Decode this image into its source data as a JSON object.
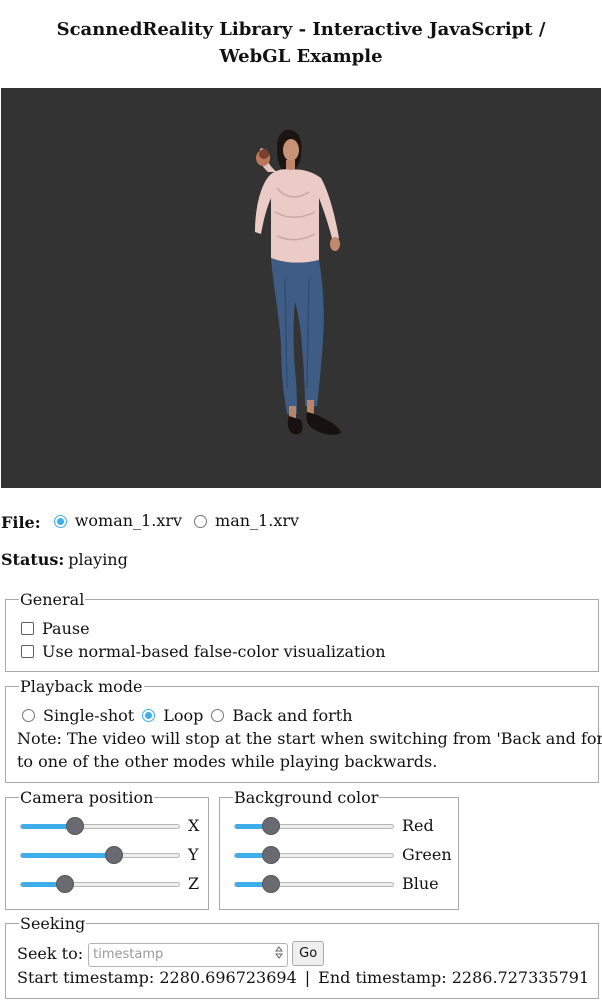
{
  "page": {
    "title": "ScannedReality Library - Interactive JavaScript / WebGL Example"
  },
  "viewer": {
    "background": "#333333"
  },
  "file": {
    "label": "File:",
    "options": [
      {
        "label": "woman_1.xrv",
        "checked": true
      },
      {
        "label": "man_1.xrv",
        "checked": false
      }
    ]
  },
  "status": {
    "label": "Status:",
    "value": "playing"
  },
  "general": {
    "legend": "General",
    "options": [
      {
        "label": "Pause",
        "checked": false
      },
      {
        "label": "Use normal-based false-color visualization",
        "checked": false
      }
    ]
  },
  "playback": {
    "legend": "Playback mode",
    "options": [
      {
        "label": "Single-shot",
        "checked": false
      },
      {
        "label": "Loop",
        "checked": true
      },
      {
        "label": "Back and forth",
        "checked": false
      }
    ],
    "note_line1": "Note: The video will stop at the start when switching from 'Back and forth'",
    "note_line2": "to one of the other modes while playing backwards."
  },
  "camera": {
    "legend": "Camera position",
    "sliders": [
      {
        "axis": "X",
        "value": 0.34
      },
      {
        "axis": "Y",
        "value": 0.59
      },
      {
        "axis": "Z",
        "value": 0.28
      }
    ]
  },
  "background_color": {
    "legend": "Background color",
    "sliders": [
      {
        "channel": "Red",
        "value": 0.23
      },
      {
        "channel": "Green",
        "value": 0.23
      },
      {
        "channel": "Blue",
        "value": 0.23
      }
    ]
  },
  "seeking": {
    "legend": "Seeking",
    "seek_label": "Seek to:",
    "placeholder": "timestamp",
    "go_label": "Go",
    "start_text": "Start timestamp: 2280.696723694",
    "separator": "|",
    "end_text": "End timestamp: 2286.727335791"
  },
  "colors": {
    "accent": "#3daee9",
    "thumb": "#6a6a72"
  }
}
